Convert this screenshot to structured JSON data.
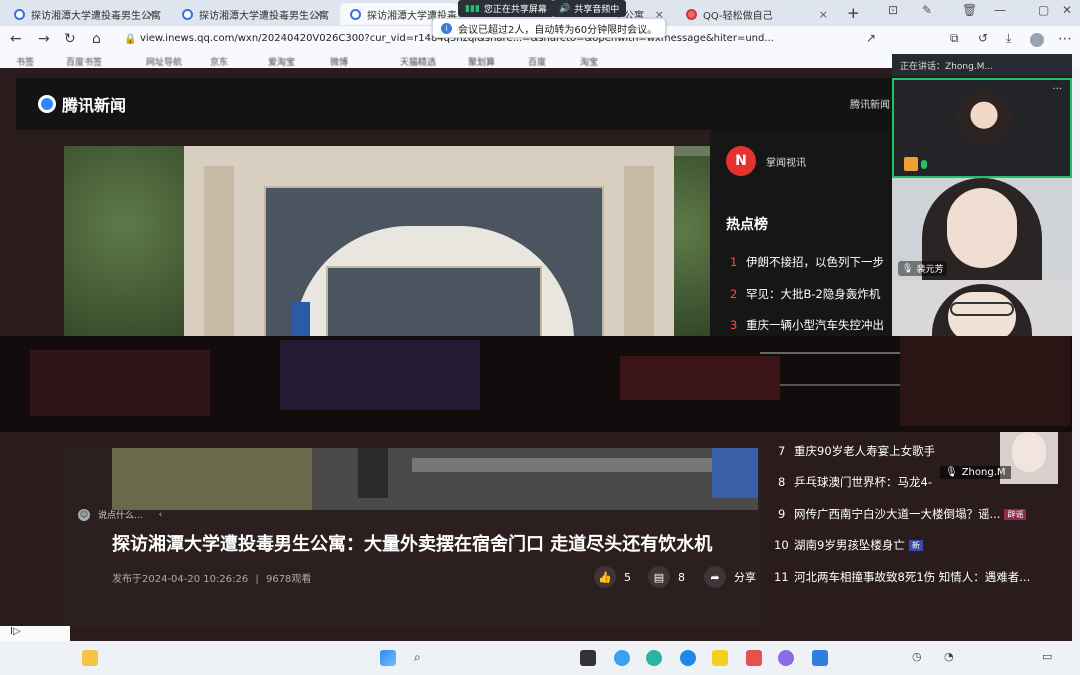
{
  "browser": {
    "tabs": [
      {
        "label": "探访湘潭大学遭投毒男生公寓",
        "close": "×"
      },
      {
        "label": "探访湘潭大学遭投毒男生公寓",
        "close": "×"
      },
      {
        "label": "探访湘潭大学遭投毒男生公寓",
        "close": "×"
      },
      {
        "label": "生公寓",
        "close": "×"
      },
      {
        "label": "QQ-轻松做自己",
        "close": "×"
      }
    ],
    "new_tab": "+",
    "url": "view.inews.qq.com/wxn/20240420V026C300?cur_vid=r1484q5nzqi&share...=&shareto=&openwith=wxmessage&hiter=und..."
  },
  "meeting_banner": {
    "sharing": "您正在共享屏幕",
    "audio": "共享音频中",
    "notice": "会议已超过2人，自动转为60分钟限时会议。"
  },
  "bookmarks": [
    "书签",
    "百度书签",
    "网址导航",
    "京东",
    "爱淘宝",
    "微博",
    "天猫精选",
    "聚划算",
    "百度",
    "淘宝"
  ],
  "site": {
    "logo": "腾讯新闻",
    "header_link": "腾讯新闻"
  },
  "sidebar": {
    "channel": "掌闻视讯",
    "channel_logo": "N",
    "hot_title": "热点榜",
    "hot_top": [
      {
        "rank": "1",
        "text": "伊朗不接招，以色列下一步"
      },
      {
        "rank": "2",
        "text": "罕见：大批B-2隐身轰炸机"
      },
      {
        "rank": "3",
        "text": "重庆一辆小型汽车失控冲出"
      }
    ],
    "hot_bottom": [
      {
        "rank": "7",
        "text": "重庆90岁老人寿宴上女歌手",
        "tag": ""
      },
      {
        "rank": "8",
        "text": "乒乓球澳门世界杯：马龙4-",
        "tag": ""
      },
      {
        "rank": "9",
        "text": "网传广西南宁白沙大道一大楼倒塌？谣...",
        "tag": "辟谣"
      },
      {
        "rank": "10",
        "text": "湖南9岁男孩坠楼身亡",
        "tag": "新"
      },
      {
        "rank": "11",
        "text": "河北两车相撞事故致8死1伤 知情人：遇难者...",
        "tag": ""
      }
    ]
  },
  "article": {
    "comment_placeholder": "说点什么...",
    "title": "探访湘潭大学遭投毒男生公寓：大量外卖摆在宿舍门口 走道尽头还有饮水机",
    "published": "发布于2024-04-20 10:26:26",
    "separator": "|",
    "views": "9678观看",
    "likes": "5",
    "comments": "8",
    "share": "分享"
  },
  "meeting": {
    "header": "正在讲话：Zhong.M...",
    "participants": [
      {
        "name": ""
      },
      {
        "name": "裴元芳"
      },
      {
        "name": ""
      }
    ],
    "floating_name": "Zhong.M",
    "more": "···"
  },
  "colors": {
    "accent_red": "#ff4a3a",
    "speaking_green": "#21c16b",
    "page_bg": "#2a1c1c"
  }
}
